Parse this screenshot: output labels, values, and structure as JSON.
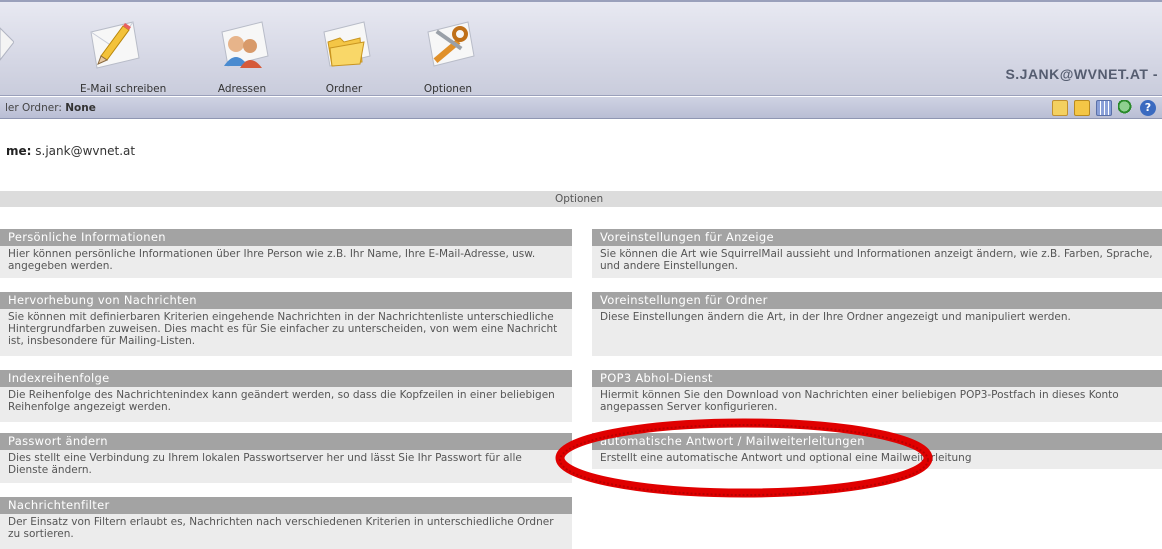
{
  "toolbar": {
    "items": [
      {
        "label": "E-Mail schreiben",
        "icon": "compose-pencil-icon"
      },
      {
        "label": "Adressen",
        "icon": "addressbook-icon"
      },
      {
        "label": "Ordner",
        "icon": "folder-icon"
      },
      {
        "label": "Optionen",
        "icon": "options-tools-icon"
      }
    ],
    "user_email": "S.JANK@WVNET.AT -"
  },
  "folderbar": {
    "prefix": "ler Ordner: ",
    "current_folder": "None",
    "icons": [
      "note-icon",
      "folder-star-icon",
      "calendar-grid-icon",
      "search-magnifier-icon",
      "help-icon"
    ]
  },
  "welcome": {
    "prefix": "me:",
    "user": "s.jank@wvnet.at"
  },
  "options": {
    "header": "Optionen",
    "left": [
      {
        "title": "Persönliche Informationen",
        "desc": "Hier können persönliche Informationen über Ihre Person wie z.B. Ihr Name, Ihre E-Mail-Adresse, usw. angegeben werden."
      },
      {
        "title": "Hervorhebung von Nachrichten",
        "desc": "Sie können mit definierbaren Kriterien eingehende Nachrichten in der Nachrichtenliste unterschiedliche Hintergrundfarben zuweisen. Dies macht es für Sie einfacher zu unterscheiden, von wem eine Nachricht ist, insbesondere für Mailing-Listen."
      },
      {
        "title": "Indexreihenfolge",
        "desc": "Die Reihenfolge des Nachrichtenindex kann geändert werden, so dass die Kopfzeilen in einer beliebigen Reihenfolge angezeigt werden."
      },
      {
        "title": "Passwort ändern",
        "desc": "Dies stellt eine Verbindung zu Ihrem lokalen Passwortserver her und lässt Sie Ihr Passwort für alle Dienste ändern."
      },
      {
        "title": "Nachrichtenfilter",
        "desc": "Der Einsatz von Filtern erlaubt es, Nachrichten nach verschiedenen Kriterien in unterschiedliche Ordner zu sortieren."
      }
    ],
    "right": [
      {
        "title": "Voreinstellungen für Anzeige",
        "desc": "Sie können die Art wie SquirrelMail aussieht und Informationen anzeigt ändern, wie z.B. Farben, Sprache, und andere Einstellungen."
      },
      {
        "title": "Voreinstellungen für Ordner",
        "desc": "Diese Einstellungen ändern die Art, in der Ihre Ordner angezeigt und manipuliert werden."
      },
      {
        "title": "POP3 Abhol-Dienst",
        "desc": "Hiermit können Sie den Download von Nachrichten einer beliebigen POP3-Postfach in dieses Konto angepassen Server konfigurieren."
      },
      {
        "title": "automatische Antwort / Mailweiterleitungen",
        "desc": "Erstellt eine automatische Antwort und optional eine Mailweiterleitung"
      }
    ]
  },
  "colors": {
    "section_title_bg": "#a3a3a3",
    "section_body_bg": "#ececec",
    "annotation_red": "#e00000"
  }
}
